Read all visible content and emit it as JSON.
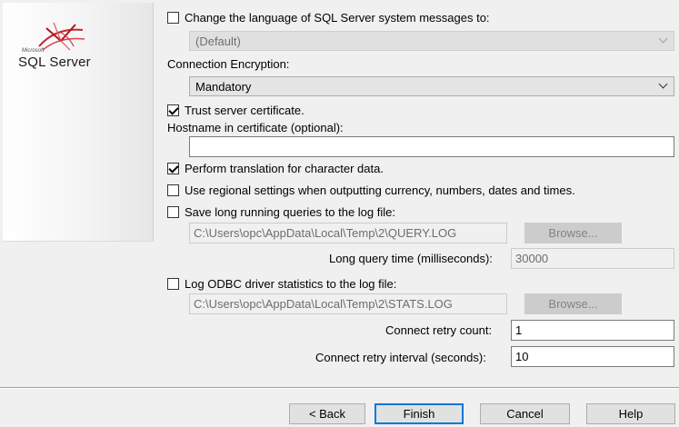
{
  "branding": {
    "small_text": "Microsoft",
    "product_name": "SQL Server"
  },
  "language": {
    "checkbox_label": "Change the language of SQL Server system messages to:",
    "checked": false,
    "select_value": "(Default)"
  },
  "encryption": {
    "label": "Connection Encryption:",
    "select_value": "Mandatory"
  },
  "trust_cert": {
    "checkbox_label": "Trust server certificate.",
    "checked": true
  },
  "hostname": {
    "label": "Hostname in certificate (optional):",
    "value": ""
  },
  "translation": {
    "checkbox_label": "Perform translation for character data.",
    "checked": true
  },
  "regional": {
    "checkbox_label": "Use regional settings when outputting currency, numbers, dates and times.",
    "checked": false
  },
  "long_queries": {
    "checkbox_label": "Save long running queries to the log file:",
    "checked": false,
    "path": "C:\\Users\\opc\\AppData\\Local\\Temp\\2\\QUERY.LOG",
    "browse_label": "Browse...",
    "time_label": "Long query time (milliseconds):",
    "time_value": "30000"
  },
  "odbc_stats": {
    "checkbox_label": "Log ODBC driver statistics to the log file:",
    "checked": false,
    "path": "C:\\Users\\opc\\AppData\\Local\\Temp\\2\\STATS.LOG",
    "browse_label": "Browse..."
  },
  "retry": {
    "count_label": "Connect retry count:",
    "count_value": "1",
    "interval_label": "Connect retry interval (seconds):",
    "interval_value": "10"
  },
  "buttons": {
    "back": "< Back",
    "finish": "Finish",
    "cancel": "Cancel",
    "help": "Help"
  }
}
